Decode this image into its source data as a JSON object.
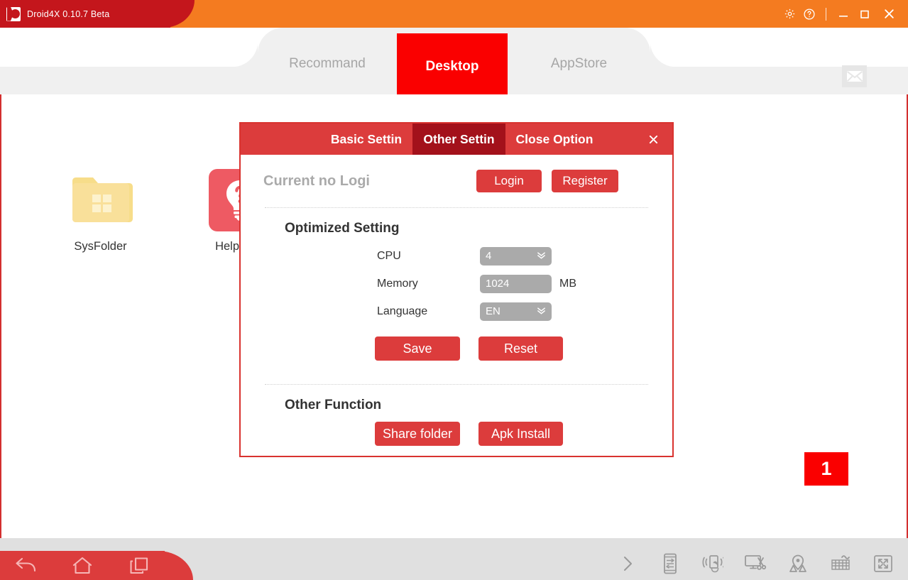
{
  "window": {
    "title": "Droid4X 0.10.7 Beta",
    "logo_icon": "droid4x-logo-icon",
    "controls": [
      {
        "name": "settings-gear-icon",
        "label": "Settings"
      },
      {
        "name": "help-question-icon",
        "label": "Help"
      },
      {
        "name": "minimize-icon",
        "label": "Minimize"
      },
      {
        "name": "maximize-icon",
        "label": "Maximize"
      },
      {
        "name": "close-icon",
        "label": "Close"
      }
    ],
    "colors": {
      "titlebar_left": "#c4161c",
      "titlebar_right": "#f47b20",
      "accent_red": "#dc3c3c",
      "active_tab_red": "#fa0000"
    }
  },
  "tabs": {
    "items": [
      {
        "label": "Recommand",
        "active": false
      },
      {
        "label": "Desktop",
        "active": true
      },
      {
        "label": "AppStore",
        "active": false
      }
    ],
    "mail_icon": "mail-envelope-icon"
  },
  "desktop": {
    "icons": [
      {
        "label": "SysFolder",
        "icon": "folder-icon"
      },
      {
        "label": "HelpCent",
        "icon": "help-lightbulb-icon"
      }
    ],
    "badge": "1"
  },
  "dialog": {
    "tabs": [
      {
        "label": "Basic Settin",
        "active": false
      },
      {
        "label": "Other Settin",
        "active": true
      },
      {
        "label": "Close Option",
        "active": false
      }
    ],
    "close_icon": "dialog-close-icon",
    "login": {
      "status": "Current no Logi",
      "login_label": "Login",
      "register_label": "Register"
    },
    "optimized": {
      "title": "Optimized Setting",
      "cpu_label": "CPU",
      "cpu_value": "4",
      "memory_label": "Memory",
      "memory_value": "1024",
      "memory_unit": "MB",
      "language_label": "Language",
      "language_value": "EN",
      "save_label": "Save",
      "reset_label": "Reset"
    },
    "other": {
      "title": "Other Function",
      "share_label": "Share folder",
      "apk_label": "Apk Install"
    }
  },
  "bottombar": {
    "nav": [
      {
        "name": "back-icon",
        "label": "Back"
      },
      {
        "name": "home-icon",
        "label": "Home"
      },
      {
        "name": "recent-apps-icon",
        "label": "Recent apps"
      }
    ],
    "tools": [
      {
        "name": "expand-chevron-icon",
        "label": "More"
      },
      {
        "name": "volume-device-icon",
        "label": "Volume"
      },
      {
        "name": "shake-device-icon",
        "label": "Shake"
      },
      {
        "name": "screenshot-icon",
        "label": "Screenshot"
      },
      {
        "name": "location-icon",
        "label": "Location"
      },
      {
        "name": "keyboard-mapping-icon",
        "label": "Key mapping"
      },
      {
        "name": "fullscreen-icon",
        "label": "Fullscreen"
      }
    ]
  }
}
